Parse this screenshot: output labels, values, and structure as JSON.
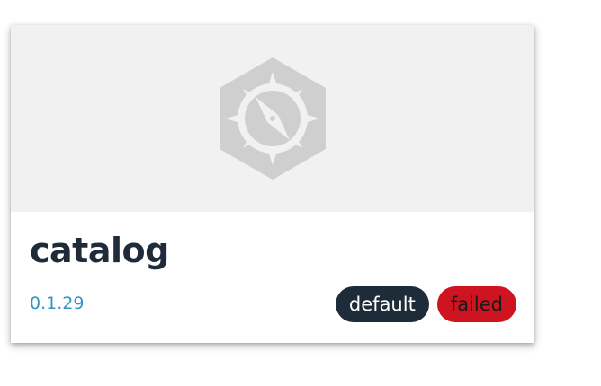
{
  "card": {
    "title": "catalog",
    "version": "0.1.29",
    "image_icon": "compass-hexagon-icon",
    "badges": [
      {
        "label": "default",
        "color": "#1e2b38"
      },
      {
        "label": "failed",
        "color": "#cd1420"
      }
    ]
  },
  "colors": {
    "title": "#1f2b38",
    "version_link": "#2e95c4",
    "image_background": "#f1f1f1",
    "icon": "#cfcfcf"
  }
}
